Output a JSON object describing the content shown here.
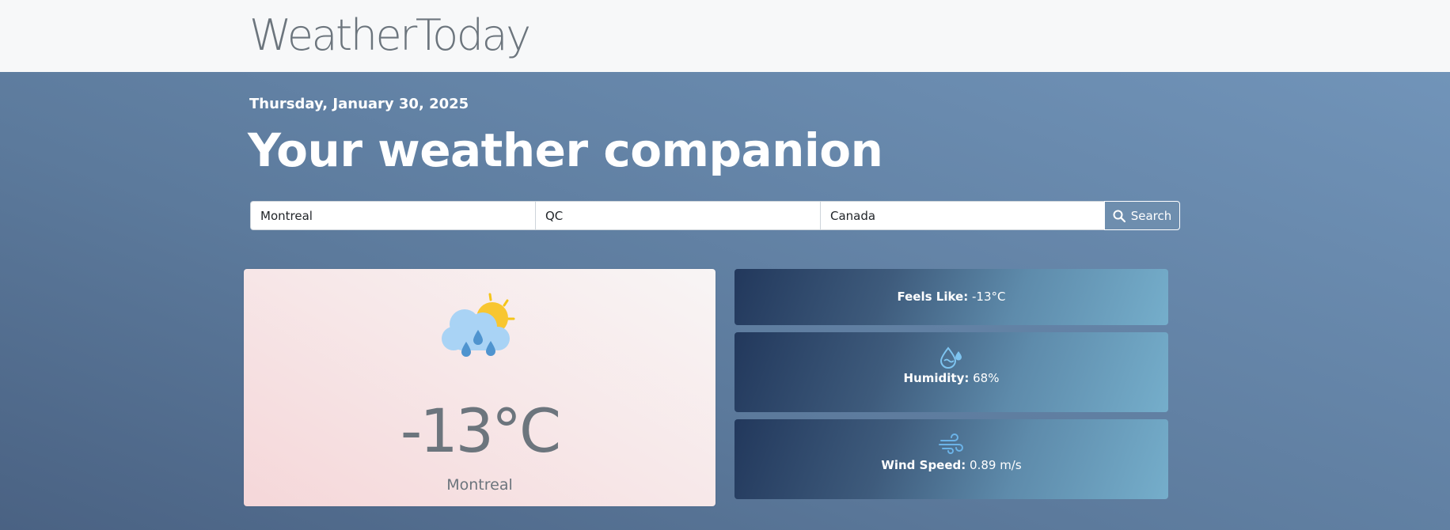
{
  "header": {
    "brand": "WeatherToday"
  },
  "hero": {
    "date": "Thursday, January 30, 2025",
    "headline": "Your weather companion"
  },
  "search": {
    "city": {
      "value": "Montreal"
    },
    "region": {
      "value": "QC"
    },
    "country": {
      "value": "Canada"
    },
    "button_label": "Search",
    "button_icon": "search-icon"
  },
  "current": {
    "icon": "rain-sun-icon",
    "temperature": "-13°C",
    "city": "Montreal"
  },
  "stats": {
    "feels_like": {
      "label": "Feels Like:",
      "value": " -13°C"
    },
    "humidity": {
      "label": "Humidity:",
      "value": " 68%",
      "icon": "humidity-icon"
    },
    "wind": {
      "label": "Wind Speed:",
      "value": " 0.89 m/s",
      "icon": "wind-icon"
    }
  },
  "colors": {
    "accent_blue": "#6e8eae",
    "icon_blue": "#5aa0d8",
    "sun_yellow": "#f5c518"
  }
}
